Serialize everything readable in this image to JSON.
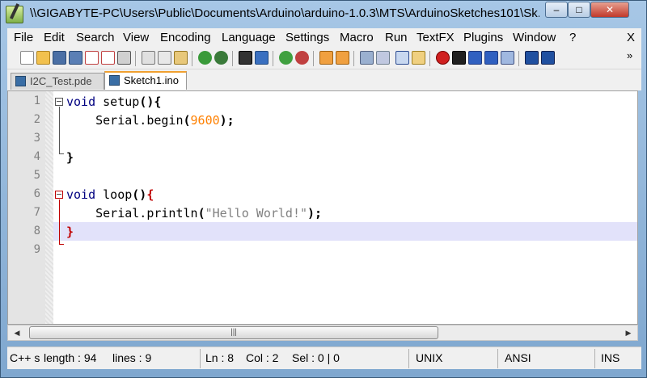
{
  "window": {
    "title": "\\\\GIGABYTE-PC\\Users\\Public\\Documents\\Arduino\\arduino-1.0.3\\MTS\\ArduinoSketches101\\Sk...",
    "minimize_glyph": "–",
    "maximize_glyph": "□",
    "close_glyph": "✕"
  },
  "menu": {
    "items": [
      "File",
      "Edit",
      "Search",
      "View",
      "Encoding",
      "Language",
      "Settings",
      "Macro",
      "Run",
      "TextFX",
      "Plugins",
      "Window",
      "?"
    ],
    "close_label": "X"
  },
  "toolbar": {
    "more_glyph": "»"
  },
  "tabs": [
    {
      "label": "I2C_Test.pde",
      "active": false
    },
    {
      "label": "Sketch1.ino",
      "active": true
    }
  ],
  "editor": {
    "line_numbers": [
      "1",
      "2",
      "3",
      "4",
      "5",
      "6",
      "7",
      "8",
      "9"
    ],
    "current_line": 8,
    "code": {
      "l1_kw": "void",
      "l1_rest": " setup",
      "l1_paren": "()",
      "l1_brace": "{",
      "l2_obj": "    Serial.begin",
      "l2_open": "(",
      "l2_num": "9600",
      "l2_close": ");",
      "l4_brace": "}",
      "l6_kw": "void",
      "l6_rest": " loop",
      "l6_paren": "()",
      "l6_brace": "{",
      "l7_obj": "    Serial.println",
      "l7_open": "(",
      "l7_str": "\"Hello World!\"",
      "l7_close": ");",
      "l8_brace": "}"
    }
  },
  "scrollbar": {
    "left_arrow": "◀",
    "right_arrow": "▶",
    "thumb_grip": "|||"
  },
  "status": {
    "file_type": "C++ s",
    "length": "length : 94",
    "lines": "lines : 9",
    "ln": "Ln : 8",
    "col": "Col : 2",
    "sel": "Sel : 0 | 0",
    "eol": "UNIX",
    "encoding": "ANSI",
    "mode": "INS"
  }
}
